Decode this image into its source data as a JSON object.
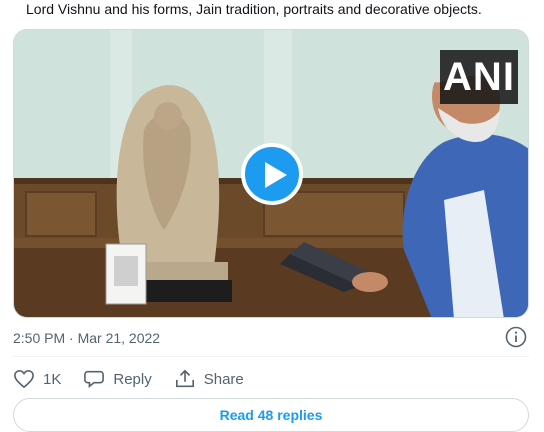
{
  "tweet": {
    "text": "Lord Vishnu and his forms, Jain tradition, portraits and decorative objects.",
    "timestamp": "2:50 PM · Mar 21, 2022",
    "video_watermark": "ANI"
  },
  "actions": {
    "like_count": "1K",
    "reply_label": "Reply",
    "share_label": "Share"
  },
  "read_replies_label": "Read 48 replies",
  "colors": {
    "accent": "#1d9bf0",
    "muted": "#536471"
  },
  "icons": [
    "play-icon",
    "info-icon",
    "heart-icon",
    "reply-icon",
    "share-icon"
  ]
}
